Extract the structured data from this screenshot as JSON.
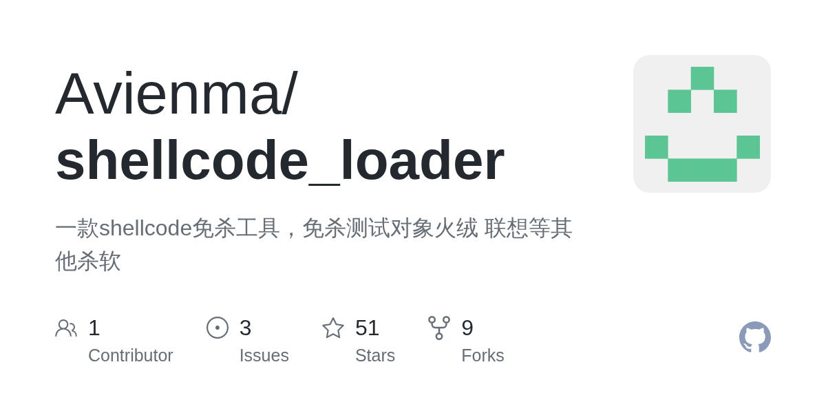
{
  "owner": "Avienma/",
  "repository": "shellcode_loader",
  "description": "一款shellcode免杀工具，免杀测试对象火绒 联想等其他杀软",
  "stats": [
    {
      "kind": "contributors",
      "value": "1",
      "label": "Contributor"
    },
    {
      "kind": "issues",
      "value": "3",
      "label": "Issues"
    },
    {
      "kind": "stars",
      "value": "51",
      "label": "Stars"
    },
    {
      "kind": "forks",
      "value": "9",
      "label": "Forks"
    }
  ]
}
